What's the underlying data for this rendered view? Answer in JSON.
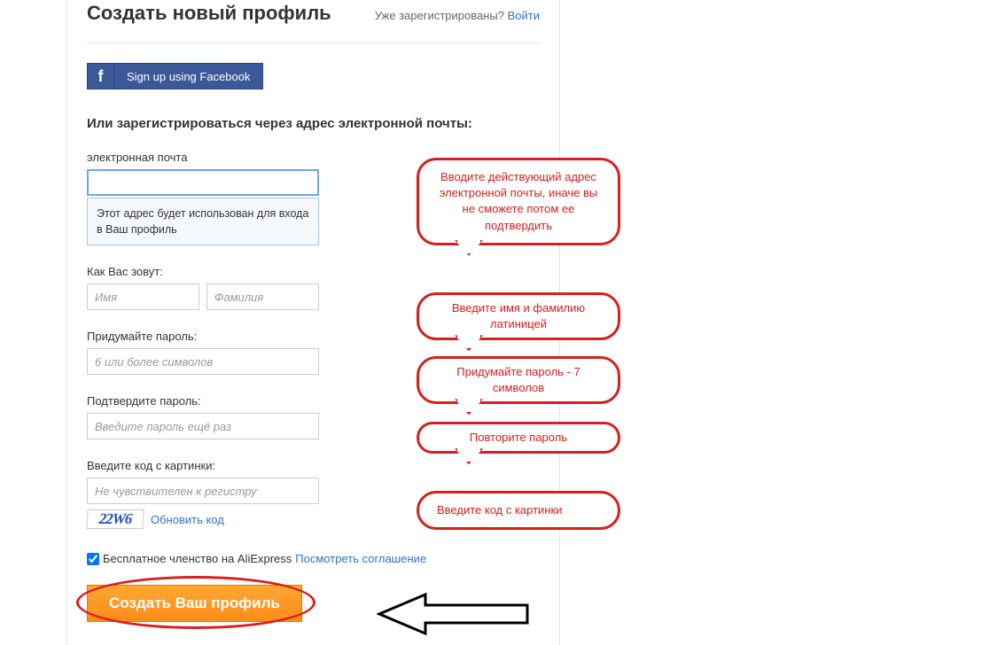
{
  "header": {
    "title": "Создать новый профиль",
    "already_text": "Уже зарегистрированы? ",
    "login_link": "Войти"
  },
  "facebook": {
    "icon_glyph": "f",
    "label": "Sign up using Facebook"
  },
  "sub_heading": "Или зарегистрироваться через адрес электронной почты:",
  "email": {
    "label": "электронная почта",
    "value": "",
    "hint": "Этот адрес будет использован для входа в Ваш профиль"
  },
  "name": {
    "label": "Как Вас зовут:",
    "first_placeholder": "Имя",
    "last_placeholder": "Фамилия"
  },
  "password": {
    "label": "Придумайте пароль:",
    "placeholder": "6 или более символов"
  },
  "password_confirm": {
    "label": "Подтвердите пароль:",
    "placeholder": "Введите пароль ещё раз"
  },
  "captcha": {
    "label": "Введите код с картинки:",
    "placeholder": "Не чувствителен к регистру",
    "code": "22W6",
    "refresh": "Обновить код"
  },
  "agreement": {
    "checked": true,
    "text": "Бесплатное членство на AliExpress ",
    "link": "Посмотреть соглашение"
  },
  "submit": {
    "label": "Создать Ваш профиль"
  },
  "annotations": {
    "email": "Вводите действующий адрес электронной почты, иначе вы не сможете потом ее подтвердить",
    "name": "Введите имя и фамилию латиницей",
    "password": "Придумайте пароль - 7 символов",
    "confirm": "Повторите пароль",
    "captcha": "Введите код с картинки"
  }
}
